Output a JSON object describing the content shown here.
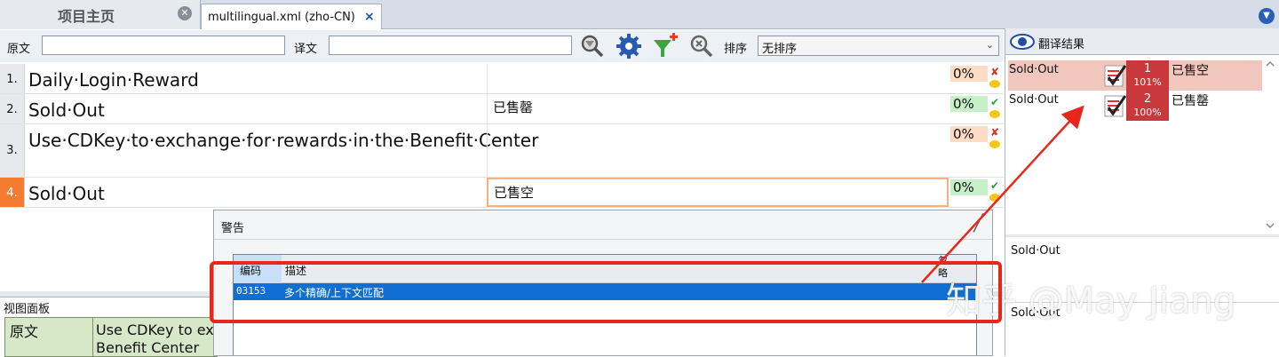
{
  "tabs": {
    "home_label": "项目主页",
    "file_label": "multilingual.xml (zho-CN)",
    "close_glyph": "×"
  },
  "filter": {
    "source_label": "原文",
    "target_label": "译文",
    "source_value": "",
    "target_value": "",
    "sort_label": "排序",
    "sort_value": "无排序"
  },
  "grid": {
    "rows": [
      {
        "num": "1.",
        "source": "Daily·Login·Reward",
        "target": "",
        "match": "0%",
        "status": "✘"
      },
      {
        "num": "2.",
        "source": "Sold·Out",
        "target": "已售罄",
        "match": "0%",
        "status": "✔"
      },
      {
        "num": "3.",
        "source": "Use·CDKey·to·exchange·for·rewards·in·the·Benefit·Center",
        "target": "",
        "match": "0%",
        "status": "✘"
      },
      {
        "num": "4.",
        "source": "Sold·Out",
        "target": "已售空",
        "match": "0%",
        "status": "✔"
      }
    ]
  },
  "view_panel": {
    "title": "视图面板",
    "key": "原文",
    "value_line1": "Use CDKey to exc",
    "value_line2": "Benefit Center"
  },
  "warning_dialog": {
    "title": "警告",
    "columns": [
      "编码",
      "描述",
      "忽略"
    ],
    "rows": [
      {
        "code": "03153",
        "description": "多个精确/上下文匹配"
      }
    ]
  },
  "translation_results": {
    "title": "翻译结果",
    "items": [
      {
        "source": "Sold·Out",
        "rank": "1",
        "score": "101%",
        "target": "已售空"
      },
      {
        "source": "Sold·Out",
        "rank": "2",
        "score": "100%",
        "target": "已售罄"
      }
    ],
    "context_1": "Sold·Out",
    "context_2": "Sold·Out"
  },
  "watermark": "知乎 @May Jiang",
  "colors": {
    "selected_row_number": "#f47c30",
    "match_red_bg": "#fcdcc5",
    "match_green_bg": "#c8f0c8",
    "annotation_red": "#e8261c",
    "tm_badge": "#c9393b",
    "list_selection": "#0f6fd2"
  }
}
